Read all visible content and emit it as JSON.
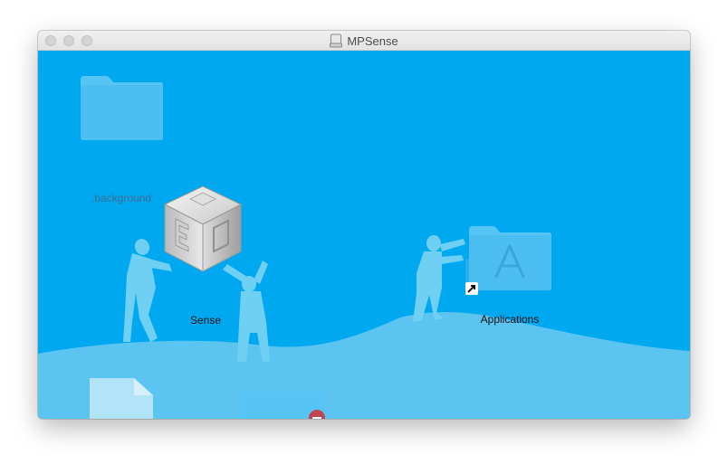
{
  "window": {
    "title": "MPSense"
  },
  "icons": {
    "background_folder": {
      "label": ".background"
    },
    "app": {
      "label": "Sense"
    },
    "applications": {
      "label": "Applications"
    }
  },
  "colors": {
    "background": "#00a8f0",
    "hill": "#5cc4f0",
    "folder": "#55c6f7",
    "silhouette": "#6fd0f4"
  }
}
